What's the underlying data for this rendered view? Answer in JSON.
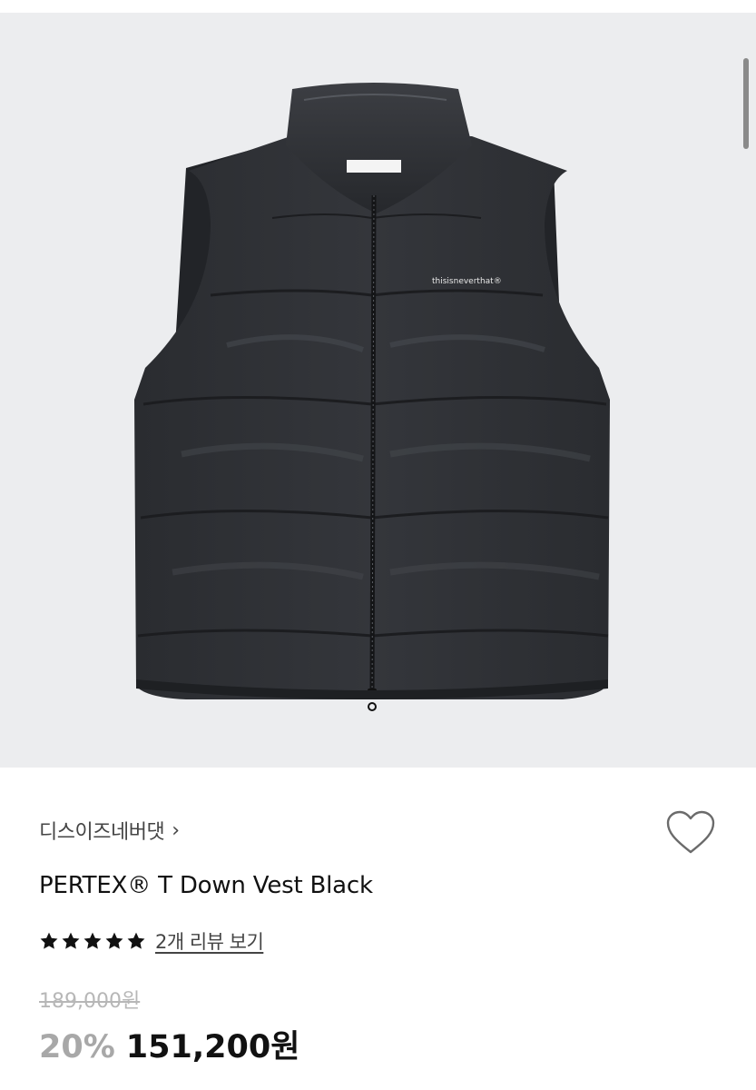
{
  "product": {
    "image_alt": "PERTEX® T Down Vest Black",
    "vest_logo_text": "thisisneverthat®",
    "brand": "디스이즈네버댓",
    "name": "PERTEX® T Down Vest Black",
    "rating": 5,
    "review_link": "2개 리뷰 보기",
    "original_price": "189,000원",
    "discount": "20%",
    "final_price": "151,200원"
  },
  "icons": {
    "brand_chevron": "chevron-right-icon",
    "wishlist": "heart-outline-icon",
    "rating": "star-icon"
  },
  "colors": {
    "hero_bg": "#ecedef",
    "text_primary": "#111111",
    "text_secondary": "#444444",
    "text_muted": "#b7b7b7",
    "discount": "#a8a8a8"
  }
}
